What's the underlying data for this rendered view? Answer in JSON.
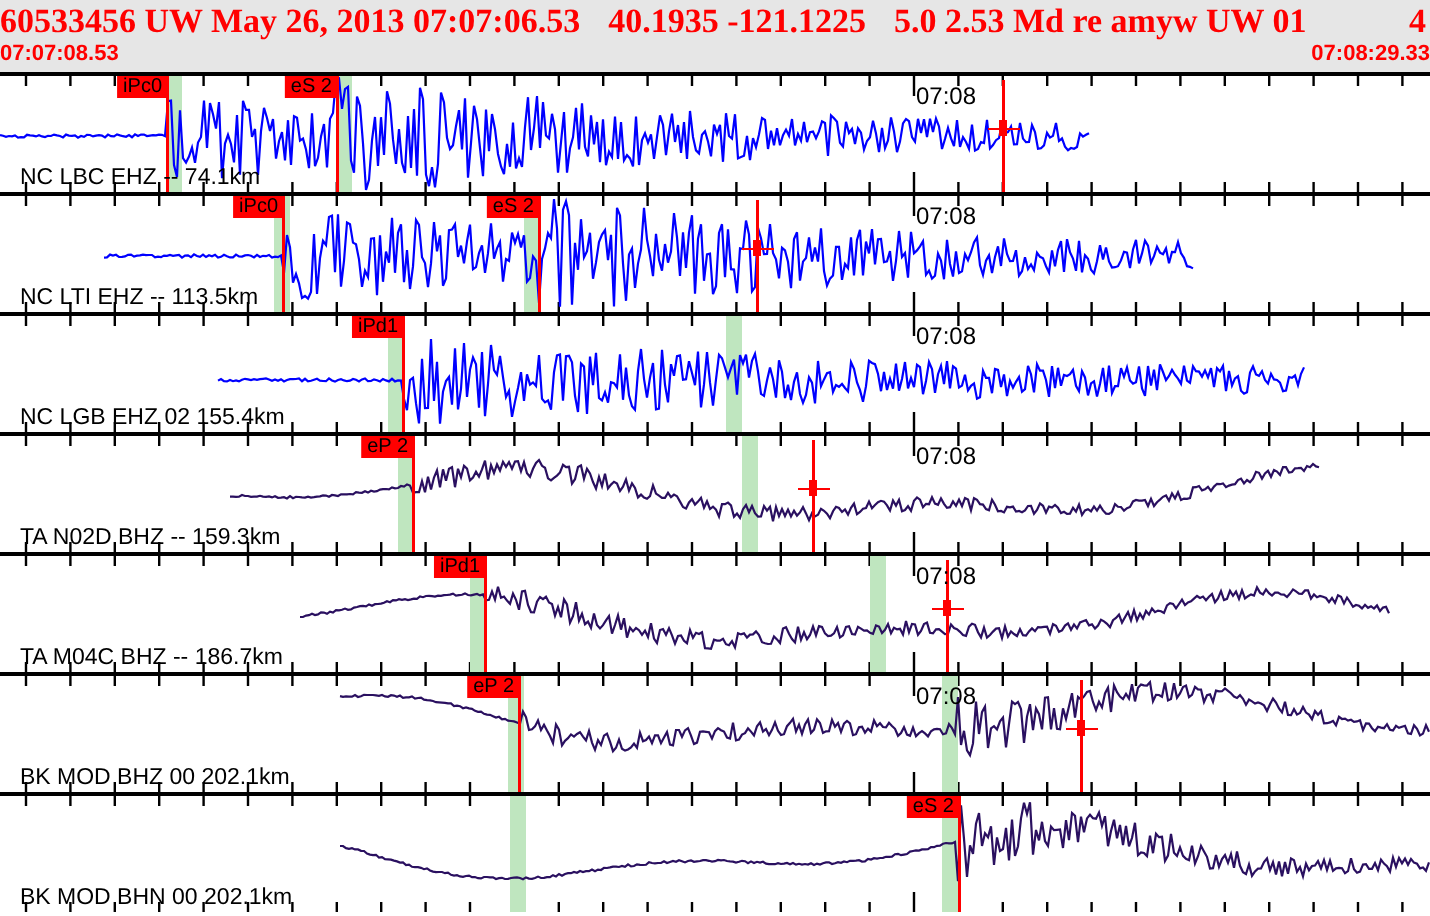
{
  "header": {
    "title_parts": [
      "60533456 UW May 26, 2013 07:07:06.53",
      "40.1935 -121.1225",
      "5.0 2.53 Md re amyw UW 01",
      "4"
    ],
    "start_time": "07:07:08.53",
    "end_time": "07:08:29.33"
  },
  "traces": [
    {
      "label": "NC LBC EHZ -- 74.1km",
      "color": "#0000ff",
      "time_label": "07:08",
      "picks": [
        {
          "label": "iPc0"
        },
        {
          "label": "eS 2"
        }
      ]
    },
    {
      "label": "NC LTI EHZ -- 113.5km",
      "color": "#0000ff",
      "time_label": "07:08",
      "picks": [
        {
          "label": "iPc0"
        },
        {
          "label": "eS 2"
        }
      ]
    },
    {
      "label": "NC LGB EHZ 02 155.4km",
      "color": "#0000ff",
      "time_label": "07:08",
      "picks": [
        {
          "label": "iPd1"
        }
      ]
    },
    {
      "label": "TA N02D BHZ -- 159.3km",
      "color": "#2a1060",
      "time_label": "07:08",
      "picks": [
        {
          "label": "eP 2"
        }
      ]
    },
    {
      "label": "TA M04C BHZ -- 186.7km",
      "color": "#2a1060",
      "time_label": "07:08",
      "picks": [
        {
          "label": "iPd1"
        }
      ]
    },
    {
      "label": "BK MOD BHZ 00 202.1km",
      "color": "#2a1060",
      "time_label": "07:08",
      "picks": [
        {
          "label": "eP 2"
        }
      ]
    },
    {
      "label": "BK MOD BHN 00 202.1km",
      "color": "#2a1060",
      "picks": [
        {
          "label": "eS 2"
        }
      ]
    }
  ]
}
